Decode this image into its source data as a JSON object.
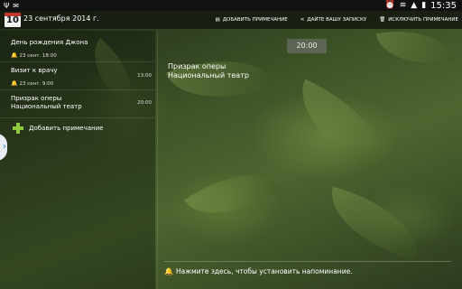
{
  "status": {
    "clock": "15:35"
  },
  "header": {
    "calendar_day": "10",
    "date_title": "23 сентября 2014 г.",
    "actions": [
      {
        "label": "ДОБАВИТЬ ПРИМЕЧАНИЕ",
        "icon": "note-add-icon"
      },
      {
        "label": "ДАЙТЕ ВАШУ ЗАПИСКУ",
        "icon": "share-icon"
      },
      {
        "label": "ИСКЛЮЧИТЬ ПРИМЕЧАНИЕ",
        "icon": "trash-icon"
      }
    ]
  },
  "events": [
    {
      "title": "День рождения Джона",
      "subtitle": "23 сент. 18:00",
      "time": ""
    },
    {
      "title": "Визит к врачу",
      "subtitle": "23 сент. 9:00",
      "time": "13:00"
    },
    {
      "title": "Призрак оперы\nНациональный театр",
      "subtitle": "",
      "time": "20:00"
    }
  ],
  "add_note_label": "Добавить примечание",
  "detail": {
    "time": "20:00",
    "title": "Призрак оперы",
    "location": "Национальный театр",
    "reminder_text": "Нажмите здесь, чтобы установить напоминание."
  },
  "colors": {
    "accent_green": "#8fc83b",
    "drawer_arrow": "#2b73b8",
    "calendar_red": "#c0392b"
  }
}
